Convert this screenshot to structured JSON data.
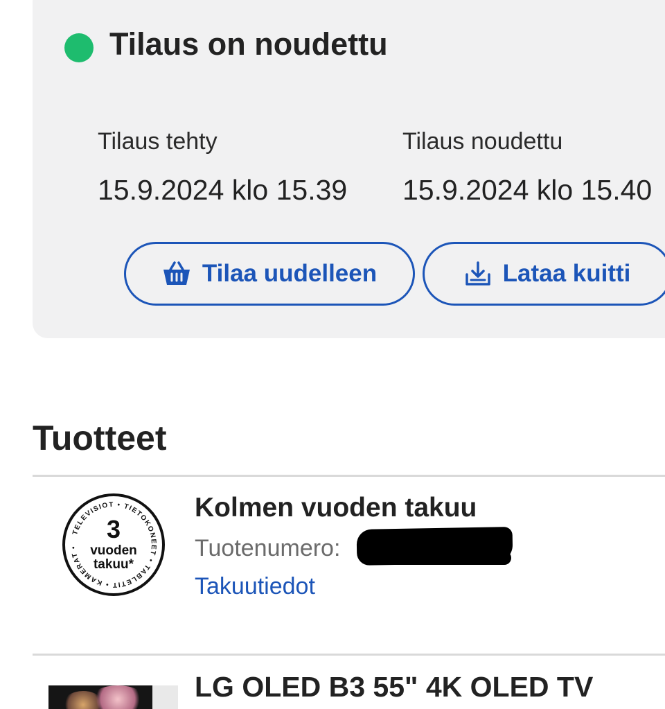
{
  "status": {
    "title": "Tilaus on noudettu",
    "dot_color": "#1ebc6e"
  },
  "order_info": {
    "created_label": "Tilaus tehty",
    "created_value": "15.9.2024 klo 15.39",
    "picked_label": "Tilaus noudettu",
    "picked_value": "15.9.2024 klo 15.40"
  },
  "actions": {
    "reorder_label": "Tilaa uudelleen",
    "reorder_icon": "basket-icon",
    "receipt_label": "Lataa kuitti",
    "receipt_icon": "download-icon",
    "accent_color": "#1c55b8"
  },
  "products": {
    "section_title": "Tuotteet",
    "items": [
      {
        "name": "Kolmen vuoden takuu",
        "number_label": "Tuotenumero:",
        "link": "Takuutiedot",
        "badge_icon": "warranty-badge-icon",
        "badge_number": "3",
        "badge_line1": "vuoden",
        "badge_line2": "takuu*",
        "badge_ring_text": "TELEVISIOT • TIETOKONEET • TABLETIT • KAMERAT •"
      },
      {
        "name": "LG OLED B3 55\" 4K OLED TV",
        "thumb_icon": "tv-thumbnail"
      }
    ]
  }
}
